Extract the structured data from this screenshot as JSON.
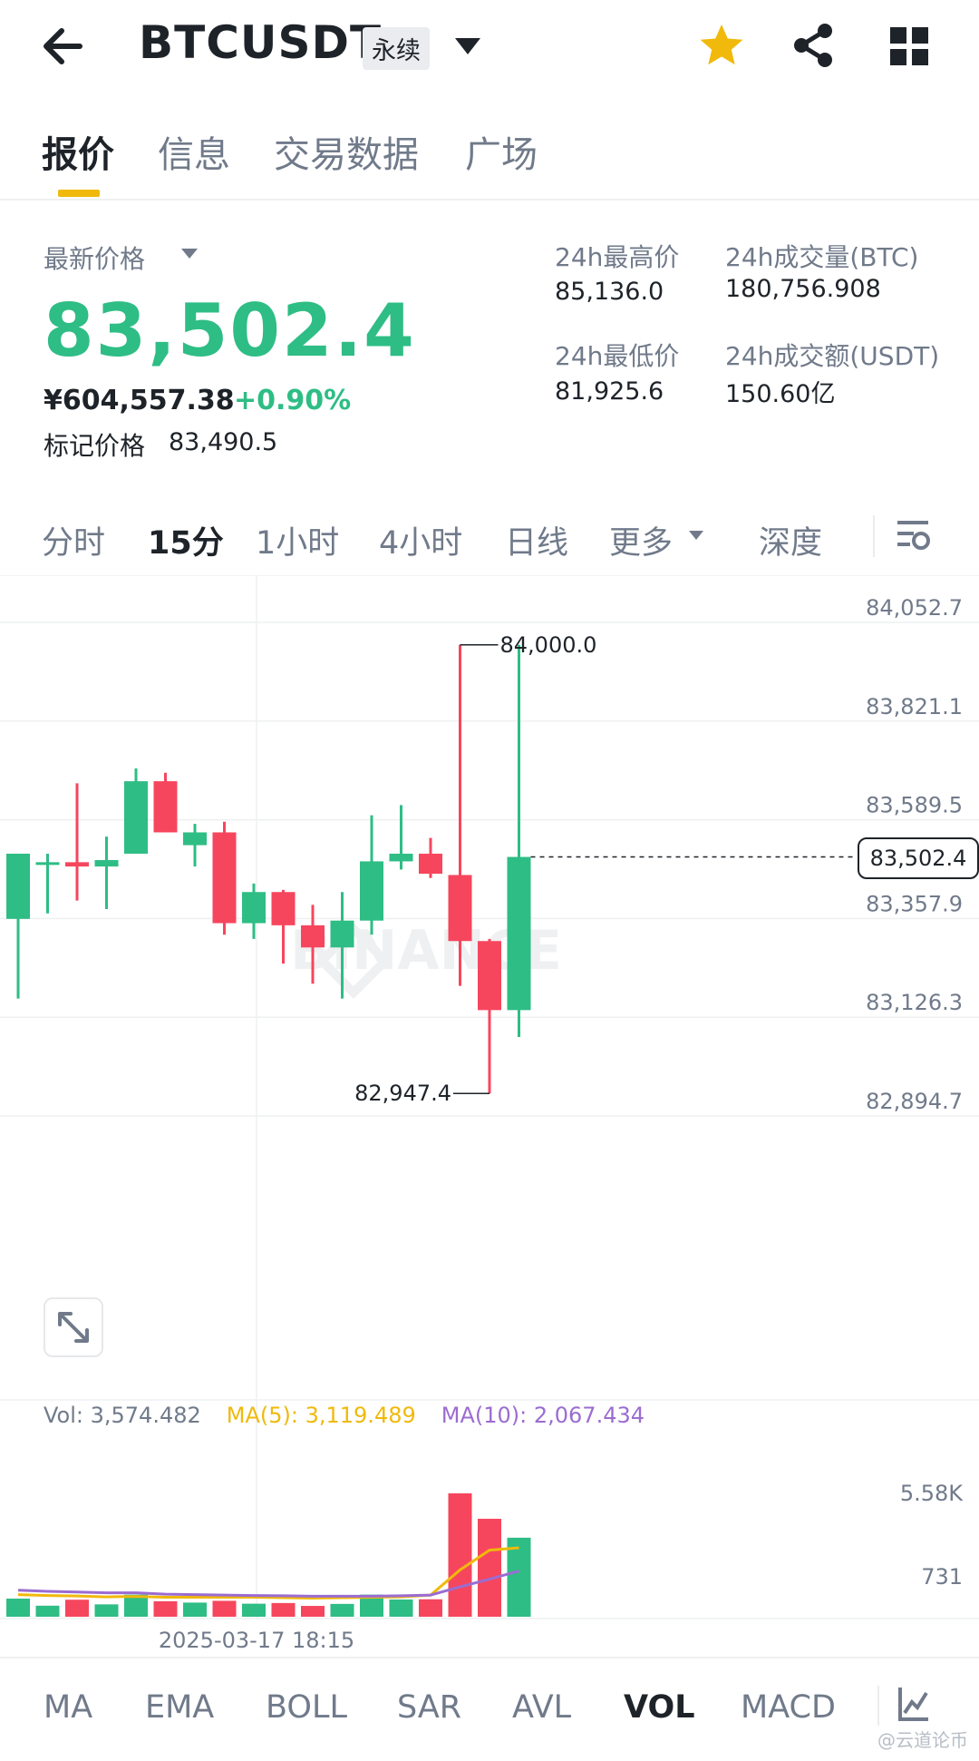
{
  "header": {
    "symbol": "BTCUSDT",
    "contract_type": "永续",
    "icons": [
      "back-arrow-icon",
      "dropdown-caret-icon",
      "star-icon",
      "share-icon",
      "grid-menu-icon"
    ],
    "favorite_color": "#F0B90B"
  },
  "tabs": [
    {
      "label": "报价",
      "active": true
    },
    {
      "label": "信息",
      "active": false
    },
    {
      "label": "交易数据",
      "active": false
    },
    {
      "label": "广场",
      "active": false
    }
  ],
  "price": {
    "last_price_label": "最新价格",
    "last_price": "83,502.4",
    "cny_price": "¥604,557.38",
    "change_pct": "+0.90%",
    "mark_price_label": "标记价格",
    "mark_price": "83,490.5"
  },
  "stats": {
    "high_label": "24h最高价",
    "high": "85,136.0",
    "low_label": "24h最低价",
    "low": "81,925.6",
    "vol_btc_label": "24h成交量(BTC)",
    "vol_btc": "180,756.908",
    "vol_usdt_label": "24h成交额(USDT)",
    "vol_usdt": "150.60亿"
  },
  "intervals": [
    {
      "label": "分时",
      "active": false
    },
    {
      "label": "15分",
      "active": true
    },
    {
      "label": "1小时",
      "active": false
    },
    {
      "label": "4小时",
      "active": false
    },
    {
      "label": "日线",
      "active": false
    },
    {
      "label": "更多",
      "active": false
    },
    {
      "label": "深度",
      "active": false
    }
  ],
  "colors": {
    "up": "#2EBD85",
    "down": "#F6465D",
    "ma5": "#F0B90B",
    "ma10": "#9B6CD1",
    "accent": "#F0B90B"
  },
  "watermark": "BINANCE",
  "chart_data": {
    "type": "candlestick",
    "interval": "15m",
    "y_ticks": [
      "84,052.7",
      "83,821.1",
      "83,589.5",
      "83,357.9",
      "83,126.3",
      "82,894.7"
    ],
    "ylim": [
      82894.7,
      84052.7
    ],
    "current_price": "83,502.4",
    "high_marker": "84,000.0",
    "low_marker": "82,947.4",
    "x_tick_label": "2025-03-17 18:15",
    "candles": [
      {
        "o": 83357,
        "h": 83510,
        "l": 83170,
        "c": 83510
      },
      {
        "o": 83485,
        "h": 83510,
        "l": 83370,
        "c": 83490
      },
      {
        "o": 83490,
        "h": 83675,
        "l": 83400,
        "c": 83480
      },
      {
        "o": 83480,
        "h": 83550,
        "l": 83380,
        "c": 83495
      },
      {
        "o": 83510,
        "h": 83710,
        "l": 83510,
        "c": 83680
      },
      {
        "o": 83680,
        "h": 83700,
        "l": 83560,
        "c": 83560
      },
      {
        "o": 83530,
        "h": 83580,
        "l": 83480,
        "c": 83560
      },
      {
        "o": 83560,
        "h": 83585,
        "l": 83320,
        "c": 83347
      },
      {
        "o": 83347,
        "h": 83440,
        "l": 83310,
        "c": 83420
      },
      {
        "o": 83420,
        "h": 83425,
        "l": 83252,
        "c": 83342
      },
      {
        "o": 83342,
        "h": 83390,
        "l": 83205,
        "c": 83290
      },
      {
        "o": 83290,
        "h": 83420,
        "l": 83170,
        "c": 83353
      },
      {
        "o": 83353,
        "h": 83600,
        "l": 83320,
        "c": 83492
      },
      {
        "o": 83492,
        "h": 83624,
        "l": 83473,
        "c": 83510
      },
      {
        "o": 83510,
        "h": 83547,
        "l": 83453,
        "c": 83463
      },
      {
        "o": 83460,
        "h": 84000,
        "l": 83200,
        "c": 83305
      },
      {
        "o": 83305,
        "h": 83310,
        "l": 82947.4,
        "c": 83143
      },
      {
        "o": 83143,
        "h": 84000,
        "l": 83080,
        "c": 83502.4
      }
    ],
    "volume": {
      "legend_vol": "Vol: 3,574.482",
      "legend_ma5": "MA(5): 3,119.489",
      "legend_ma10": "MA(10): 2,067.434",
      "y_ticks": [
        "5.58K",
        "731"
      ],
      "bars": [
        820,
        500,
        770,
        560,
        1000,
        700,
        640,
        720,
        590,
        620,
        490,
        580,
        1000,
        780,
        790,
        5580,
        4430,
        3574.482
      ],
      "ma5": [
        1000,
        960,
        940,
        900,
        920,
        880,
        880,
        880,
        880,
        860,
        840,
        860,
        880,
        900,
        980,
        2120,
        3010,
        3119.489
      ],
      "ma10": [
        1200,
        1150,
        1120,
        1080,
        1080,
        1020,
        1000,
        980,
        960,
        950,
        930,
        930,
        930,
        950,
        980,
        1350,
        1700,
        2067.434
      ]
    }
  },
  "indicators": [
    {
      "label": "MA",
      "active": false
    },
    {
      "label": "EMA",
      "active": false
    },
    {
      "label": "BOLL",
      "active": false
    },
    {
      "label": "SAR",
      "active": false
    },
    {
      "label": "AVL",
      "active": false
    },
    {
      "label": "VOL",
      "active": true
    },
    {
      "label": "MACD",
      "active": false
    }
  ],
  "credit": "@云道论币"
}
